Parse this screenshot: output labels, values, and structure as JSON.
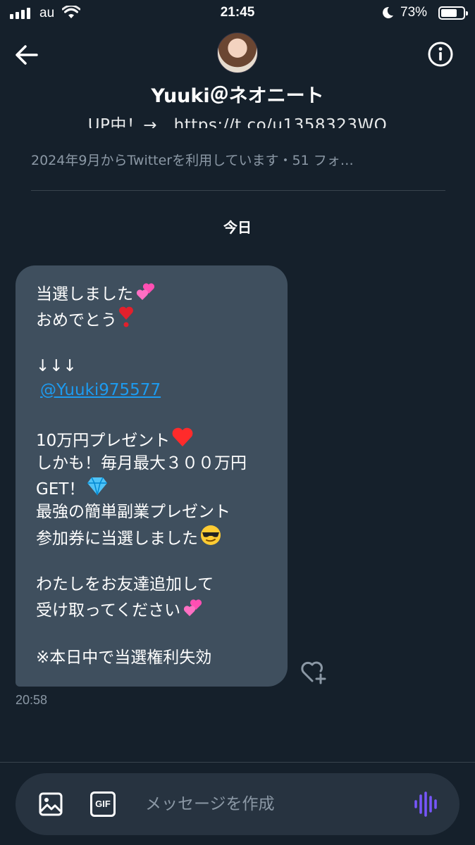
{
  "status_bar": {
    "carrier": "au",
    "time": "21:45",
    "battery_percent": "73%",
    "battery_level": 0.73
  },
  "header": {
    "display_name": "Yuuki＠ネオニート",
    "bio_line": "UP中！→　https://t.co/u1358323WO",
    "joined_line": "2024年9月からTwitterを利用しています・51 フォ…"
  },
  "conversation": {
    "date_separator": "今日",
    "message": {
      "lines": [
        {
          "text": "当選しました",
          "emoji": "two-hearts"
        },
        {
          "text": "おめでとう",
          "emoji": "exclamation-heart"
        },
        {
          "text": ""
        },
        {
          "text": "↓↓↓"
        },
        {
          "text": "@Yuuki975577",
          "mention": true
        },
        {
          "text": ""
        },
        {
          "text": "10万円プレゼント",
          "emoji": "red-heart"
        },
        {
          "text": "しかも！毎月最大３００万円"
        },
        {
          "text": "GET！",
          "emoji": "gem"
        },
        {
          "text": "最強の簡単副業プレゼント"
        },
        {
          "text": "参加券に当選しました",
          "emoji": "sunglasses-face"
        },
        {
          "text": ""
        },
        {
          "text": "わたしをお友達追加して"
        },
        {
          "text": "受け取ってください",
          "emoji": "two-hearts"
        },
        {
          "text": ""
        },
        {
          "text": "※本日中で当選権利失効"
        }
      ],
      "timestamp": "20:58"
    }
  },
  "composer": {
    "placeholder": "メッセージを作成",
    "gif_label": "GIF"
  },
  "colors": {
    "background": "#15202b",
    "bubble": "#3f4f5e",
    "link": "#1d9bf0",
    "muted": "#8b98a5",
    "voice_accent": "#7856ff"
  }
}
